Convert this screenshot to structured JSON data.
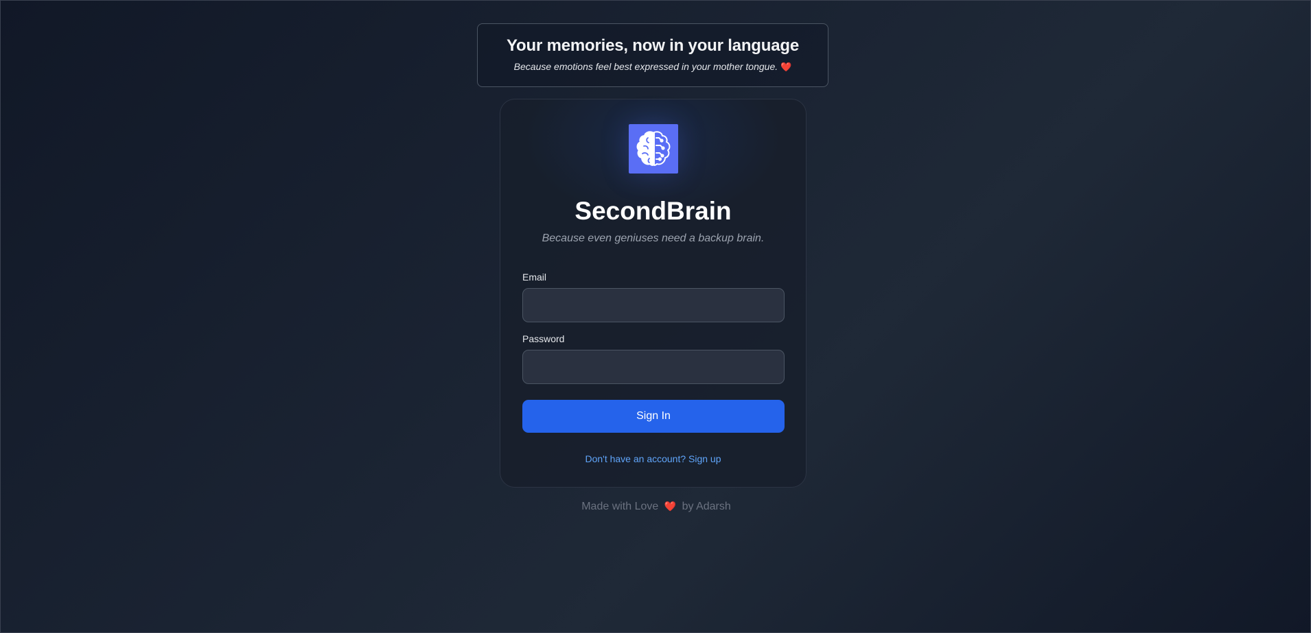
{
  "banner": {
    "title": "Your memories, now in your language",
    "subtitle": "Because emotions feel best expressed in your mother tongue.",
    "heart": "❤️"
  },
  "app": {
    "name": "SecondBrain",
    "tagline": "Because even geniuses need a backup brain.",
    "logo_icon": "brain-icon"
  },
  "form": {
    "email_label": "Email",
    "email_value": "",
    "password_label": "Password",
    "password_value": "",
    "submit_label": "Sign In",
    "signup_text": "Don't have an account? Sign up"
  },
  "footer": {
    "prefix": "Made with Love",
    "heart": "❤️",
    "suffix": "by Adarsh"
  },
  "colors": {
    "background": "#111827",
    "accent": "#2563eb",
    "link": "#60a5fa",
    "logo_bg": "#5a6ef5"
  }
}
